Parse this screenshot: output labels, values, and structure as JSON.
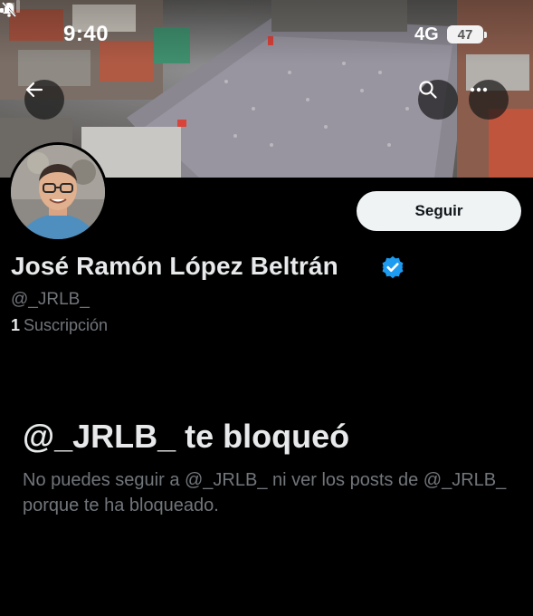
{
  "status_bar": {
    "time": "9:40",
    "network": "4G",
    "battery": "47",
    "icons": [
      "bell-slash-icon",
      "signal-icon"
    ]
  },
  "header": {
    "back_icon": "arrow-left-icon",
    "search_icon": "search-icon",
    "more_icon": "ellipsis-icon"
  },
  "profile": {
    "follow_label": "Seguir",
    "display_name": "José Ramón López Beltrán",
    "verified_icon": "verified-badge-icon",
    "handle": "@_JRLB_",
    "following_count": "1",
    "following_label": "Suscripción"
  },
  "blocked": {
    "title": "@_JRLB_ te bloqueó",
    "description": "No puedes seguir a @_JRLB_ ni ver los posts de @_JRLB_ porque te ha bloqueado."
  },
  "colors": {
    "background": "#000000",
    "primary_text": "#e7e9ea",
    "secondary_text": "#71767b",
    "verified": "#1d9bf0",
    "follow_button_bg": "#eff3f4"
  }
}
